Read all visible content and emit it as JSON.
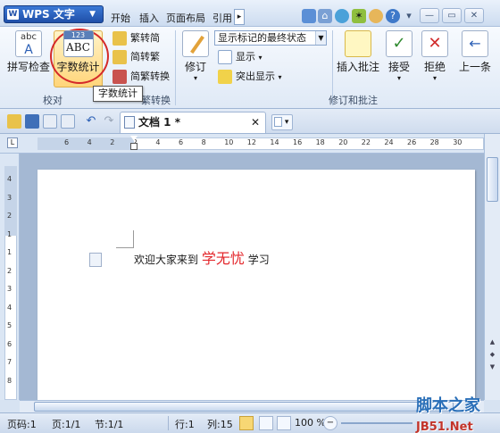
{
  "app": {
    "menu_button": "WPS 文字",
    "logo_letter": "W",
    "menu_tabs": [
      "开始",
      "插入",
      "页面布局",
      "引用"
    ],
    "more_arrow": "▸"
  },
  "ribbon": {
    "proofing_group": {
      "label": "校对",
      "spellcheck": "拼写检查",
      "word_count": "字数统计",
      "word_count_icon_text": "123",
      "spellcheck_icon_text": "abc",
      "abc_icon_text": "ABC",
      "to_traditional": "繁转简",
      "to_simplified": "简转繁",
      "convert": "简繁转换",
      "chinese_convert_group": "繁转换"
    },
    "revision_group": {
      "label": "修订和批注",
      "revise": "修订",
      "markup_state": "显示标记的最终状态",
      "show": "显示",
      "highlight_show": "突出显示",
      "insert_comment": "插入批注",
      "accept": "接受",
      "reject": "拒绝",
      "previous": "上一条"
    },
    "tooltip": "字数统计"
  },
  "tabs": {
    "doc_title": "文档 1 *",
    "close_symbol": "✕"
  },
  "ruler": {
    "corner": "L",
    "h_numbers": [
      "6",
      "4",
      "2",
      "2",
      "4",
      "6",
      "8",
      "10",
      "12",
      "14",
      "16",
      "18",
      "20",
      "22",
      "24",
      "26",
      "28",
      "30"
    ],
    "v_numbers": [
      "4",
      "3",
      "2",
      "1",
      "1",
      "2",
      "3",
      "4",
      "5",
      "6",
      "7",
      "8"
    ]
  },
  "document": {
    "text_before": "欢迎大家来到",
    "text_red": "学无忧",
    "text_after": "学习"
  },
  "status": {
    "page_code": "页码:1",
    "page": "页:1/1",
    "section": "节:1/1",
    "row": "行:1",
    "column": "列:15",
    "zoom": "100 %"
  },
  "watermark": {
    "text": "脚本之家",
    "site": "JB51.Net"
  }
}
